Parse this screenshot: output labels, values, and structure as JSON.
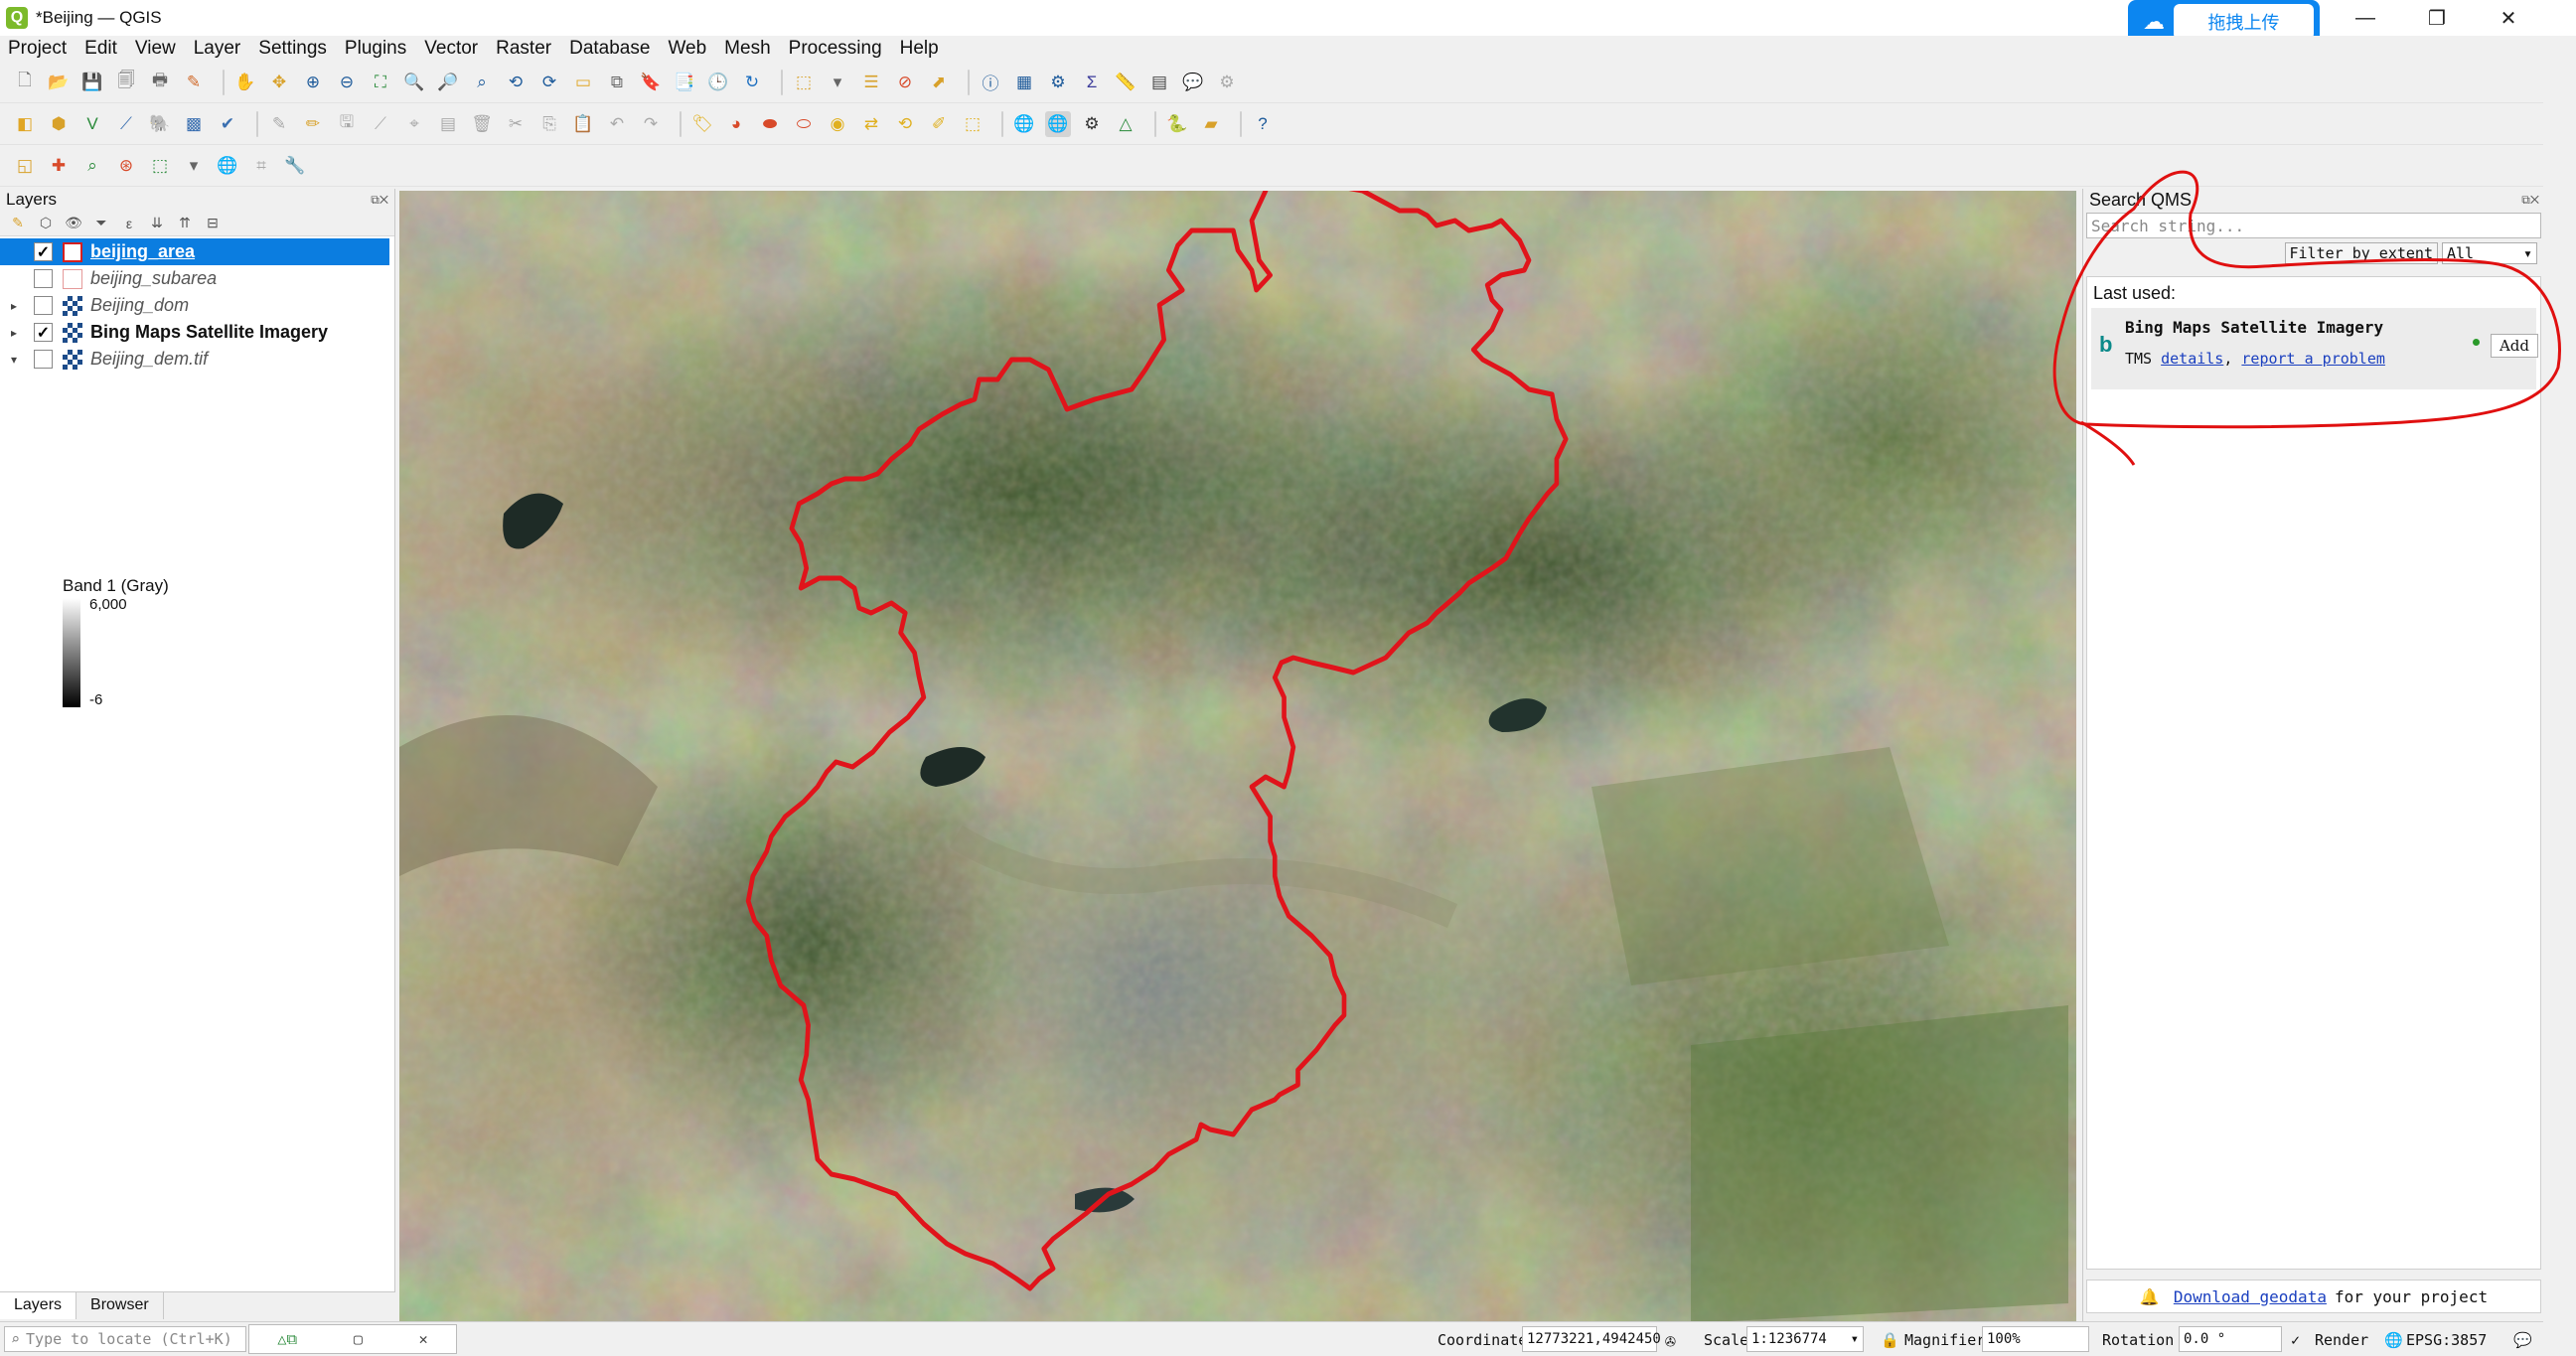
{
  "window": {
    "title": "*Beijing — QGIS",
    "app_icon": "Q",
    "upload_button": "拖拽上传"
  },
  "menu": [
    "Project",
    "Edit",
    "View",
    "Layer",
    "Settings",
    "Plugins",
    "Vector",
    "Raster",
    "Database",
    "Web",
    "Mesh",
    "Processing",
    "Help"
  ],
  "layers_panel": {
    "title": "Layers",
    "layers": [
      {
        "name": "beijing_area",
        "checked": true,
        "selected": true,
        "style": "polygon-red",
        "expander": ""
      },
      {
        "name": "beijing_subarea",
        "checked": false,
        "selected": false,
        "style": "polygon-pink",
        "expander": ""
      },
      {
        "name": "Beijing_dom",
        "checked": false,
        "selected": false,
        "style": "raster",
        "expander": "▸"
      },
      {
        "name": "Bing Maps Satellite Imagery",
        "checked": true,
        "selected": false,
        "style": "raster",
        "expander": "▸"
      },
      {
        "name": "Beijing_dem.tif",
        "checked": false,
        "selected": false,
        "style": "raster",
        "expander": "▾"
      }
    ],
    "band_label": "Band 1 (Gray)",
    "gradient_max": "6,000",
    "gradient_min": "-6",
    "tabs": [
      "Layers",
      "Browser"
    ]
  },
  "qms": {
    "title": "Search QMS",
    "search_placeholder": "Search string...",
    "filter_button": "Filter by extent",
    "filter_value": "All",
    "last_used": "Last used:",
    "item_name": "Bing Maps Satellite Imagery",
    "item_type": "TMS",
    "details_link": "details",
    "report_link": "report a problem",
    "add_button": "Add",
    "footer_link": "Download geodata",
    "footer_text": "for your project"
  },
  "status": {
    "locator_placeholder": "Type to locate (Ctrl+K)",
    "coordinate_label": "Coordinate",
    "coordinate_value": "12773221,4942450",
    "scale_label": "Scale",
    "scale_value": "1:1236774",
    "magnifier_label": "Magnifier",
    "magnifier_value": "100%",
    "rotation_label": "Rotation",
    "rotation_value": "0.0 °",
    "render_label": "Render",
    "crs_label": "EPSG:3857"
  },
  "colors": {
    "boundary": "#e0141b",
    "selection": "#0b7de0",
    "annotation": "#e01010",
    "upload": "#0c86f0"
  }
}
